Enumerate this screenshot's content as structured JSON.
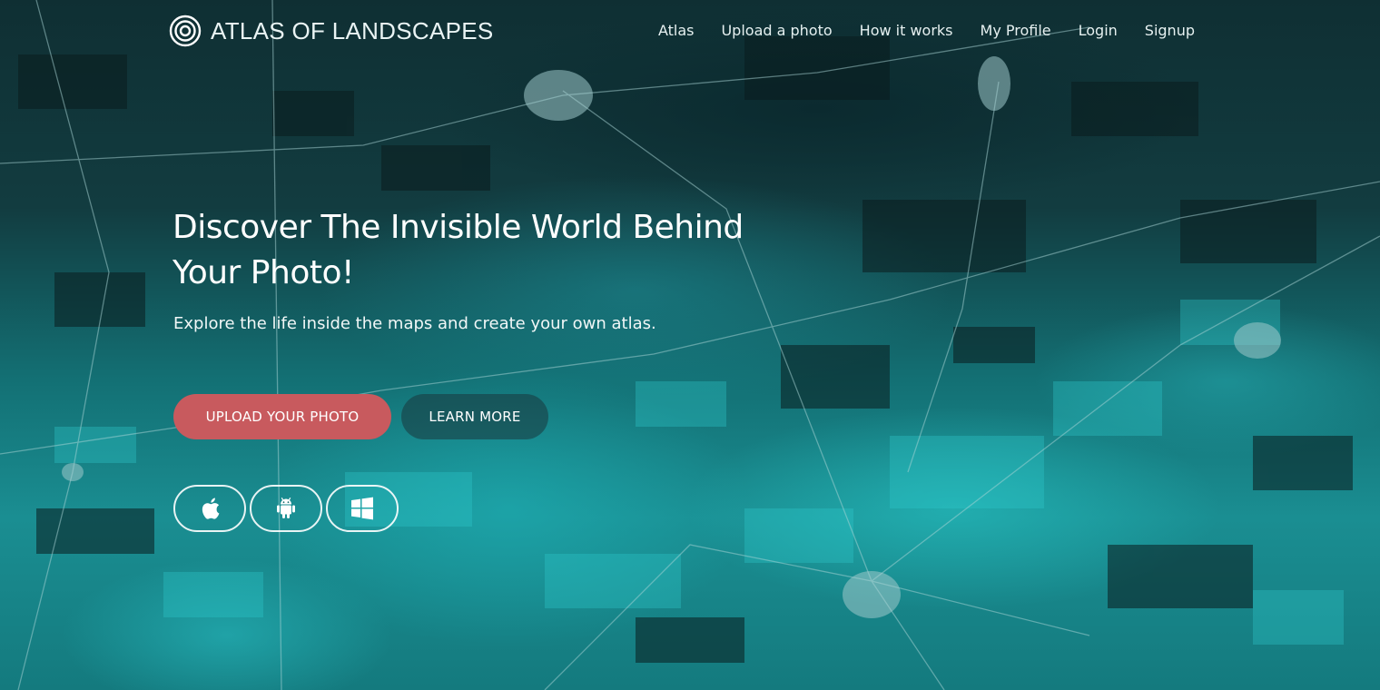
{
  "brand": {
    "name": "ATLAS OF LANDSCAPES",
    "logo_icon": "target-rings-icon"
  },
  "nav": {
    "items": [
      {
        "label": "Atlas"
      },
      {
        "label": "Upload a photo"
      },
      {
        "label": "How it works"
      },
      {
        "label": "My Profile"
      },
      {
        "label": "Login"
      },
      {
        "label": "Signup"
      }
    ]
  },
  "hero": {
    "headline_line1": "Discover The Invisible World Behind",
    "headline_line2": "Your Photo!",
    "subheadline": "Explore the life inside the maps and create your own atlas.",
    "primary_cta": "UPLOAD YOUR PHOTO",
    "secondary_cta": "LEARN MORE"
  },
  "app_stores": [
    {
      "icon": "apple-icon"
    },
    {
      "icon": "android-icon"
    },
    {
      "icon": "windows-icon"
    }
  ],
  "colors": {
    "primary_button": "#c85a5e",
    "map_teal": "#1fb3b8",
    "map_dark": "#0c2426"
  }
}
